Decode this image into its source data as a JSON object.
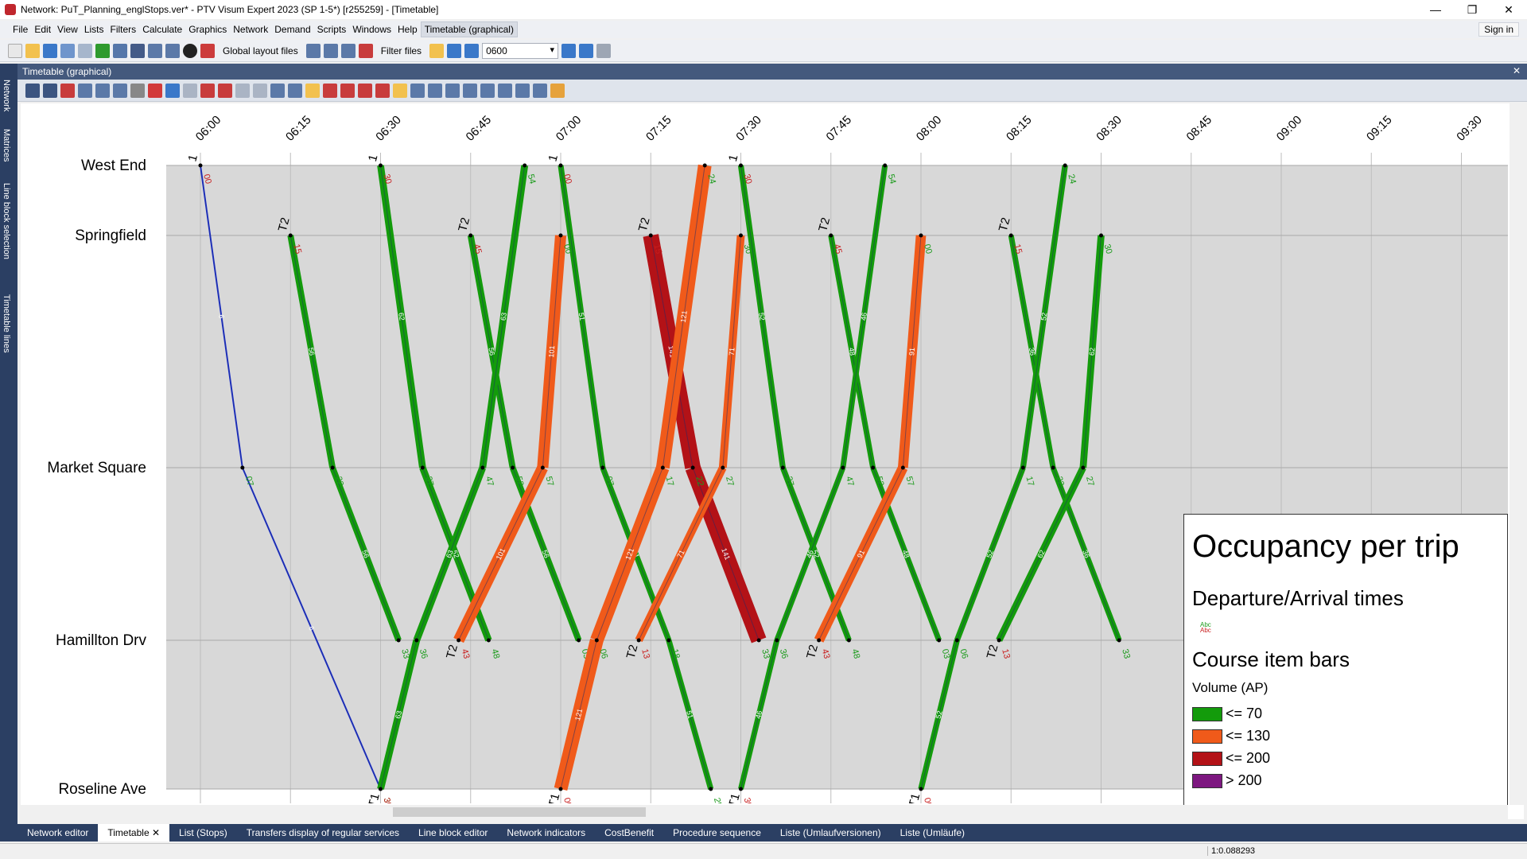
{
  "window": {
    "title": "Network: PuT_Planning_englStops.ver* - PTV Visum Expert 2023 (SP 1-5*) [r255259] - [Timetable]",
    "minimize": "—",
    "restore": "❐",
    "close": "✕"
  },
  "menu": {
    "items": [
      "File",
      "Edit",
      "View",
      "Lists",
      "Filters",
      "Calculate",
      "Graphics",
      "Network",
      "Demand",
      "Scripts",
      "Windows",
      "Help",
      "Timetable (graphical)"
    ],
    "signin": "Sign in"
  },
  "toolbar": {
    "layout_files": "Global layout files",
    "filter_files": "Filter files",
    "time_value": "0600"
  },
  "side_tabs": [
    "Network",
    "Matrices",
    "Line block selection",
    "Timetable lines"
  ],
  "panel": {
    "title": "Timetable (graphical)",
    "close": "✕"
  },
  "bottom_tabs": [
    "Network editor",
    "Timetable",
    "List (Stops)",
    "Transfers display of regular services",
    "Line block editor",
    "Network indicators",
    "CostBenefit",
    "Procedure sequence",
    "Liste (Umlaufversionen)",
    "Liste (Umläufe)"
  ],
  "bottom_tab_close": "✕",
  "status": {
    "scale": "1:0.088293"
  },
  "colors": {
    "green": "#139b0b",
    "orange": "#f05a1a",
    "darkred": "#b31217",
    "purple": "#7d1780",
    "blue": "#1e32d6",
    "red": "#ee4040",
    "grid": "#d9d9d9"
  },
  "timetable": {
    "stops": [
      "West End",
      "Springfield",
      "Market Square",
      "Hamillton Drv",
      "Roseline Ave"
    ],
    "time_labels": [
      "06:00",
      "06:15",
      "06:30",
      "06:45",
      "07:00",
      "07:15",
      "07:30",
      "07:45",
      "08:00",
      "08:15",
      "08:30",
      "08:45",
      "09:00",
      "09:15",
      "09:30"
    ],
    "line_labels": [
      "1",
      "T2",
      "T1"
    ],
    "services": [
      {
        "line": "1",
        "dep": "06:00",
        "stops": [
          [
            0,
            "06:00"
          ],
          [
            2,
            "06:07"
          ],
          [
            4,
            "06:30"
          ]
        ],
        "color": "blue",
        "volume": 6
      },
      {
        "line": "1",
        "dep": "06:30",
        "stops": [
          [
            0,
            "06:30"
          ],
          [
            2,
            "06:37"
          ],
          [
            3,
            "06:48"
          ]
        ],
        "color": "green",
        "volume": 62
      },
      {
        "line": "1",
        "dep": "07:00",
        "stops": [
          [
            0,
            "07:00"
          ],
          [
            2,
            "07:07"
          ],
          [
            3,
            "07:18"
          ],
          [
            4,
            "07:25"
          ]
        ],
        "color": "green",
        "volume": 51
      },
      {
        "line": "1",
        "dep": "07:30",
        "stops": [
          [
            0,
            "07:30"
          ],
          [
            2,
            "07:37"
          ],
          [
            3,
            "07:48"
          ]
        ],
        "color": "green",
        "volume": 52
      },
      {
        "line": "T2",
        "dep": "06:15",
        "stops": [
          [
            1,
            "06:15"
          ],
          [
            2,
            "06:22"
          ],
          [
            3,
            "06:33"
          ]
        ],
        "color": "green",
        "volume": 56
      },
      {
        "line": "T2",
        "dep": "06:45",
        "stops": [
          [
            1,
            "06:45"
          ],
          [
            2,
            "06:52"
          ],
          [
            3,
            "07:03"
          ]
        ],
        "color": "green",
        "volume": 56
      },
      {
        "line": "T2",
        "dep": "07:15",
        "stops": [
          [
            1,
            "07:15"
          ],
          [
            2,
            "07:22"
          ],
          [
            3,
            "07:33"
          ]
        ],
        "color": "darkred",
        "volume": 141
      },
      {
        "line": "T2",
        "dep": "07:45",
        "stops": [
          [
            1,
            "07:45"
          ],
          [
            2,
            "07:52"
          ],
          [
            3,
            "08:03"
          ]
        ],
        "color": "green",
        "volume": 48
      },
      {
        "line": "T2",
        "dep": "08:15",
        "stops": [
          [
            1,
            "08:15"
          ],
          [
            2,
            "08:22"
          ],
          [
            3,
            "08:33"
          ]
        ],
        "color": "green",
        "volume": 36
      },
      {
        "line": "T2",
        "dep": "06:43",
        "stops": [
          [
            3,
            "06:43"
          ],
          [
            2,
            "06:57"
          ],
          [
            1,
            "07:00"
          ]
        ],
        "color": "orange",
        "volume": 101
      },
      {
        "line": "T2",
        "dep": "07:13",
        "stops": [
          [
            3,
            "07:13"
          ],
          [
            2,
            "07:27"
          ],
          [
            1,
            "07:30"
          ]
        ],
        "color": "orange",
        "volume": 71
      },
      {
        "line": "T2",
        "dep": "07:43",
        "stops": [
          [
            3,
            "07:43"
          ],
          [
            2,
            "07:57"
          ],
          [
            1,
            "08:00"
          ]
        ],
        "color": "orange",
        "volume": 91
      },
      {
        "line": "T2",
        "dep": "08:13",
        "stops": [
          [
            3,
            "08:13"
          ],
          [
            2,
            "08:27"
          ],
          [
            1,
            "08:30"
          ]
        ],
        "color": "green",
        "volume": 62
      },
      {
        "line": "T1",
        "dep": "06:30",
        "stops": [
          [
            4,
            "06:30"
          ],
          [
            3,
            "06:36"
          ],
          [
            2,
            "06:47"
          ],
          [
            0,
            "06:54"
          ]
        ],
        "color": "green",
        "volume": 63
      },
      {
        "line": "T1",
        "dep": "07:00",
        "stops": [
          [
            4,
            "07:00"
          ],
          [
            3,
            "07:06"
          ],
          [
            2,
            "07:17"
          ],
          [
            0,
            "07:24"
          ]
        ],
        "color": "orange",
        "volume": 121
      },
      {
        "line": "T1",
        "dep": "07:30",
        "stops": [
          [
            4,
            "07:30"
          ],
          [
            3,
            "07:36"
          ],
          [
            2,
            "07:47"
          ],
          [
            0,
            "07:54"
          ]
        ],
        "color": "green",
        "volume": 46
      },
      {
        "line": "T1",
        "dep": "08:00",
        "stops": [
          [
            4,
            "08:00"
          ],
          [
            3,
            "08:06"
          ],
          [
            2,
            "08:17"
          ],
          [
            0,
            "08:24"
          ]
        ],
        "color": "green",
        "volume": 52
      }
    ]
  },
  "legend": {
    "title": "Occupancy per trip",
    "section1": "Departure/Arrival times",
    "abc": "Abc",
    "section2": "Course item bars",
    "volume_label": "Volume (AP)",
    "classes": [
      {
        "label": "<= 70",
        "color": "#139b0b"
      },
      {
        "label": "<= 130",
        "color": "#f05a1a"
      },
      {
        "label": "<= 200",
        "color": "#b31217"
      },
      {
        "label": "> 200",
        "color": "#7d1780"
      }
    ]
  }
}
